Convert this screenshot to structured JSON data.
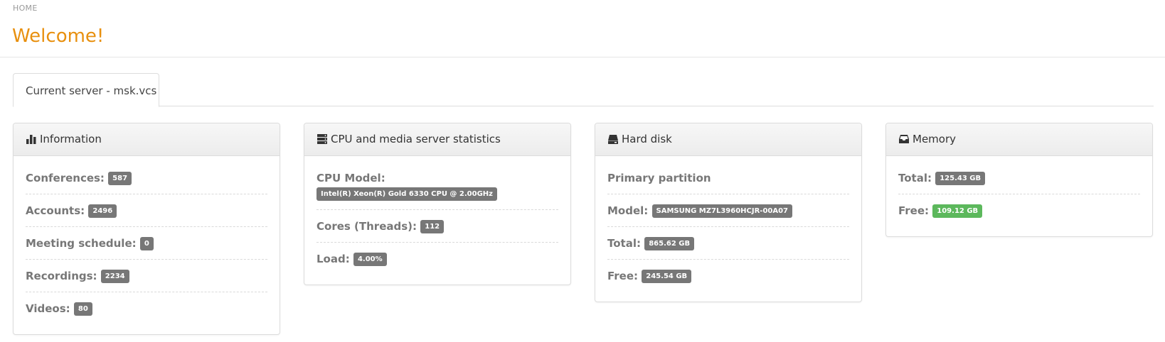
{
  "breadcrumb": "HOME",
  "page_title": "Welcome!",
  "tab": {
    "label": "Current server - msk.vcs"
  },
  "colors": {
    "title": "#e8900f",
    "badge": "#777777",
    "badge_success": "#5cb85c"
  },
  "panels": {
    "information": {
      "title": "Information",
      "icon": "bar-chart-icon",
      "rows": [
        {
          "label": "Conferences:",
          "value": "587"
        },
        {
          "label": "Accounts:",
          "value": "2496"
        },
        {
          "label": "Meeting schedule:",
          "value": "0"
        },
        {
          "label": "Recordings:",
          "value": "2234"
        },
        {
          "label": "Videos:",
          "value": "80"
        }
      ]
    },
    "cpu": {
      "title": "CPU and media server statistics",
      "icon": "server-icon",
      "rows": [
        {
          "label": "CPU Model:",
          "value": "Intel(R) Xeon(R) Gold 6330 CPU @ 2.00GHz"
        },
        {
          "label": "Cores (Threads):",
          "value": "112"
        },
        {
          "label": "Load:",
          "value": "4.00%"
        }
      ]
    },
    "disk": {
      "title": "Hard disk",
      "icon": "hard-drive-icon",
      "rows": [
        {
          "label": "Primary partition"
        },
        {
          "label": "Model:",
          "value": "SAMSUNG MZ7L3960HCJR-00A07"
        },
        {
          "label": "Total:",
          "value": "865.62 GB"
        },
        {
          "label": "Free:",
          "value": "245.54 GB"
        }
      ]
    },
    "memory": {
      "title": "Memory",
      "icon": "inbox-icon",
      "rows": [
        {
          "label": "Total:",
          "value": "125.43 GB"
        },
        {
          "label": "Free:",
          "value": "109.12 GB"
        }
      ]
    }
  }
}
